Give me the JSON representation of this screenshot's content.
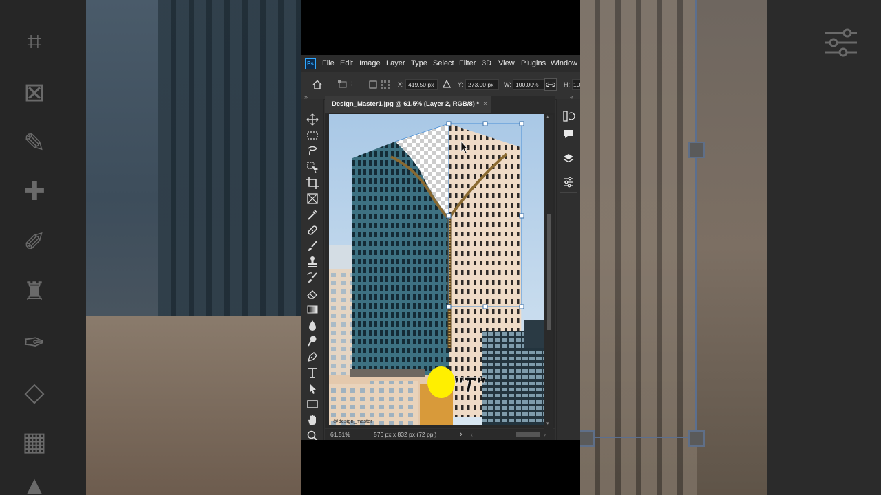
{
  "menubar": {
    "app_icon": "Ps",
    "items": [
      "File",
      "Edit",
      "Image",
      "Layer",
      "Type",
      "Select",
      "Filter",
      "3D",
      "View",
      "Plugins",
      "Window"
    ]
  },
  "options_bar": {
    "x_label": "X:",
    "x_value": "419.50 px",
    "y_label": "Y:",
    "y_value": "273.00 px",
    "w_label": "W:",
    "w_value": "100.00%",
    "h_label": "H:",
    "h_value": "10"
  },
  "document_tab": {
    "title": "Design_Master1.jpg @ 61.5% (Layer 2, RGB/8) *",
    "close": "×"
  },
  "canvas": {
    "watermark": "@design_master",
    "overlay_text": "\"T\""
  },
  "status_bar": {
    "zoom": "61.51%",
    "doc_info": "576 px x 832 px (72 ppi)",
    "arrow": "›"
  },
  "icons": {
    "toolbox": [
      "move-icon",
      "marquee-icon",
      "lasso-icon",
      "object-select-icon",
      "crop-icon",
      "frame-icon",
      "eyedropper-icon",
      "healing-icon",
      "brush-icon",
      "stamp-icon",
      "history-brush-icon",
      "eraser-icon",
      "gradient-icon",
      "blur-icon",
      "dodge-icon",
      "pen-icon",
      "type-icon",
      "path-select-icon",
      "rectangle-icon",
      "hand-icon",
      "zoom-icon"
    ],
    "right_panel": [
      "history-icon",
      "comments-icon",
      "layers-icon",
      "adjustments-icon"
    ]
  }
}
